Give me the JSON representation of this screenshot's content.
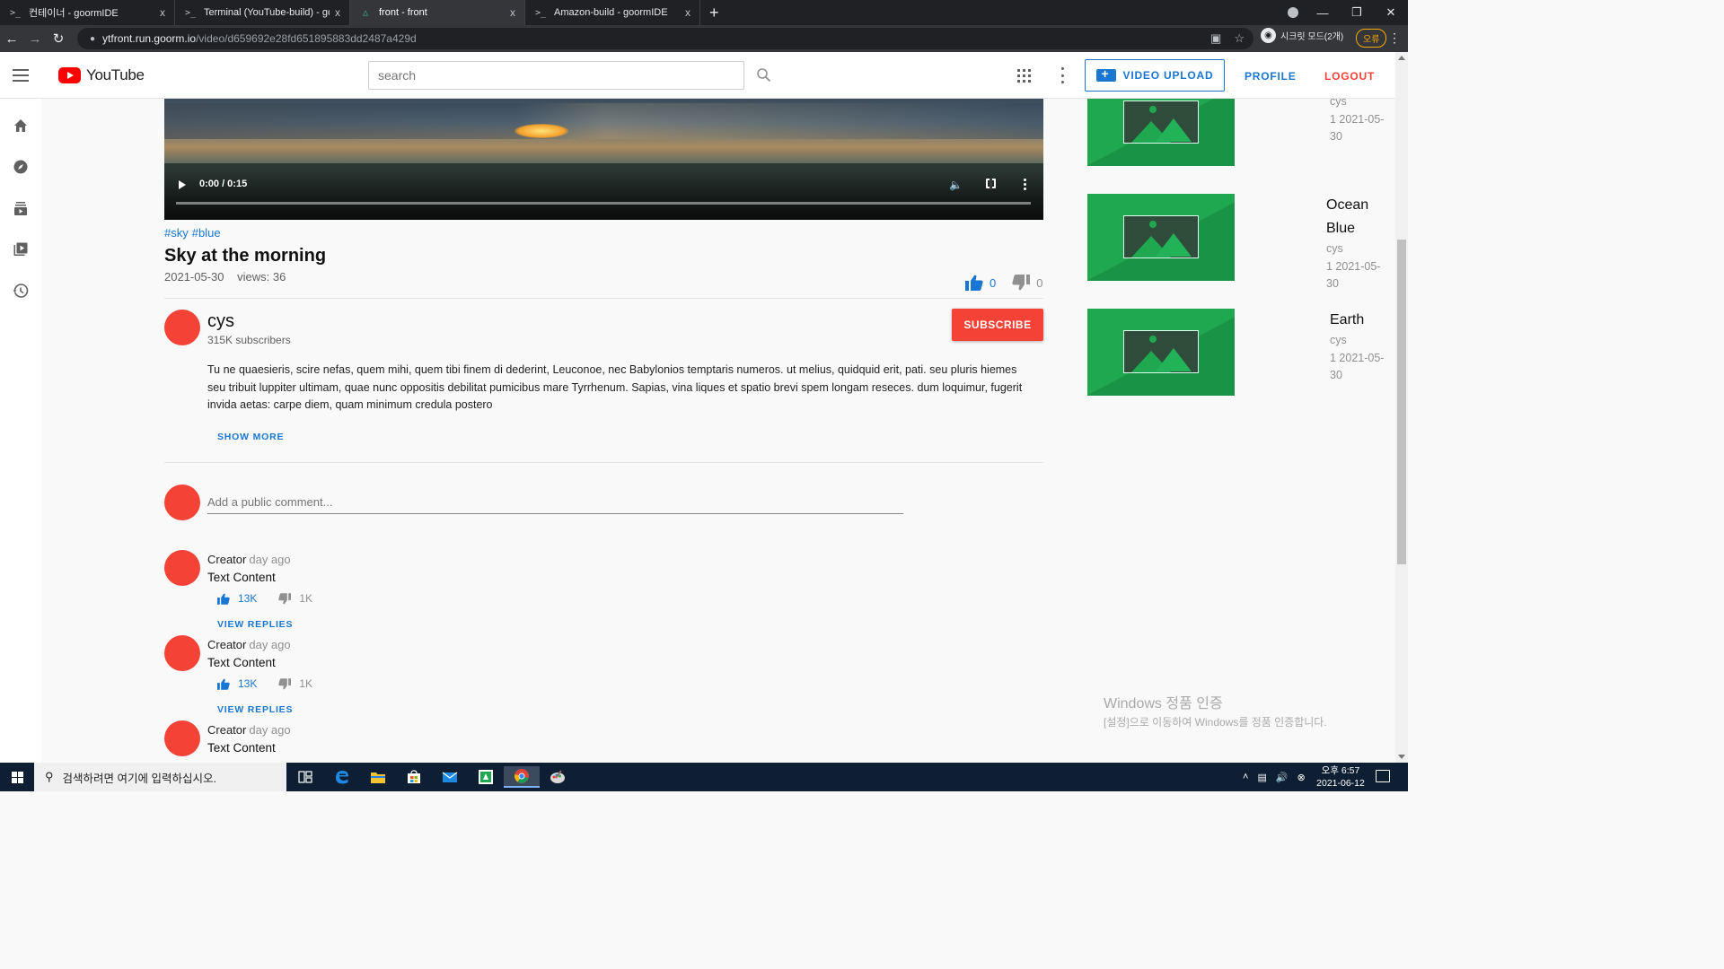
{
  "browser": {
    "tabs": [
      {
        "icon": ">_",
        "title": "컨테이너 - goormIDE",
        "close": "x"
      },
      {
        "icon": ">_",
        "title": "Terminal (YouTube-build) - goo",
        "close": "x"
      },
      {
        "icon": "△",
        "title": "front - front",
        "close": "x"
      },
      {
        "icon": ">_",
        "title": "Amazon-build - goormIDE",
        "close": "x"
      }
    ],
    "newtab": "+",
    "url_host": "ytfront.run.goorm.io",
    "url_path": "/video/d659692e28fd651895883dd2487a429d",
    "incognito_label": "시크릿 모드(2개)",
    "error_button": "오류"
  },
  "header": {
    "logo_text": "YouTube",
    "search_placeholder": "search",
    "upload_label": "VIDEO UPLOAD",
    "profile_label": "PROFILE",
    "logout_label": "LOGOUT"
  },
  "sidebar": {
    "items": [
      {
        "icon": "home-icon"
      },
      {
        "icon": "explore-icon"
      },
      {
        "icon": "subscriptions-icon"
      },
      {
        "icon": "library-icon"
      },
      {
        "icon": "history-icon"
      }
    ]
  },
  "player": {
    "time": "0:00 / 0:15",
    "progress": 0
  },
  "video": {
    "tags": [
      "#sky",
      "#blue"
    ],
    "title": "Sky at the morning",
    "date": "2021-05-30",
    "views": "views: 36",
    "likes": "0",
    "dislikes": "0"
  },
  "channel": {
    "name": "cys",
    "subscribers": "315K subscribers",
    "subscribe_label": "SUBSCRIBE",
    "description": "Tu ne quaesieris, scire nefas, quem mihi, quem tibi finem di dederint, Leuconoe, nec Babylonios temptaris numeros. ut melius, quidquid erit, pati. seu pluris hiemes seu tribuit luppiter ultimam, quae nunc oppositis debilitat pumicibus mare Tyrrhenum. Sapias, vina liques et spatio brevi spem longam reseces. dum loquimur, fugerit invida aetas: carpe diem, quam minimum credula postero",
    "show_more": "SHOW MORE"
  },
  "comments": {
    "placeholder": "Add a public comment...",
    "items": [
      {
        "author": "Creator",
        "ago": "day ago",
        "text": "Text Content",
        "likes": "13K",
        "dislikes": "1K",
        "replies": "VIEW REPLIES"
      },
      {
        "author": "Creator",
        "ago": "day ago",
        "text": "Text Content",
        "likes": "13K",
        "dislikes": "1K",
        "replies": "VIEW REPLIES"
      },
      {
        "author": "Creator",
        "ago": "day ago",
        "text": "Text Content",
        "likes": "",
        "dislikes": "",
        "replies": ""
      }
    ]
  },
  "recommendations": [
    {
      "title": "",
      "author": "cys",
      "meta": "1  2021-05-30"
    },
    {
      "title": "Ocean Blue",
      "author": "cys",
      "meta": "1  2021-05-30"
    },
    {
      "title": "Earth",
      "author": "cys",
      "meta": "1  2021-05-30"
    }
  ],
  "watermark": {
    "line1": "Windows 정품 인증",
    "line2": "[설정]으로 이동하여 Windows를 정품 인증합니다."
  },
  "taskbar": {
    "search_placeholder": "검색하려면 여기에 입력하십시오.",
    "time": "오후 6:57",
    "date": "2021-06-12"
  },
  "colors": {
    "accent": "#1976d2",
    "subscribe": "#f44336",
    "logout": "#f44336",
    "youtube_red": "#ff0000",
    "thumb_green": "#1fa84f"
  }
}
